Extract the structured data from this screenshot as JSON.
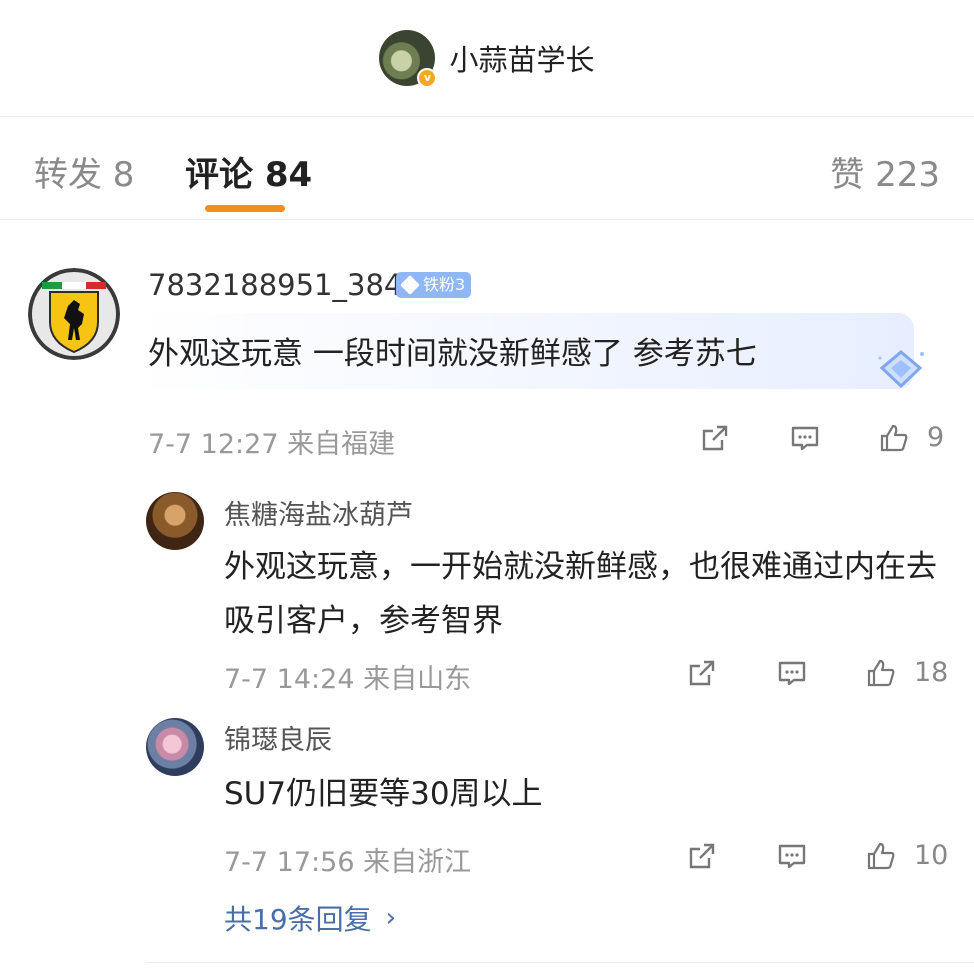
{
  "header": {
    "username": "小蒜苗学长"
  },
  "tabs": {
    "repost": "转发 8",
    "comment": "评论 84",
    "like": "赞 223"
  },
  "accent_color": "#f08f1d",
  "comments": [
    {
      "username": "7832188951_384",
      "badge": "铁粉3",
      "text": "外观这玩意 一段时间就没新鲜感了  参考苏七",
      "meta": "7-7 12:27  来自福建",
      "likes": "9"
    }
  ],
  "replies": [
    {
      "username": "焦糖海盐冰葫芦",
      "text": "外观这玩意，一开始就没新鲜感，也很难通过内在去吸引客户，参考智界",
      "meta": "7-7 14:24  来自山东",
      "likes": "18"
    },
    {
      "username": "锦璱良辰",
      "text": "SU7仍旧要等30周以上",
      "meta": "7-7 17:56  来自浙江",
      "likes": "10"
    }
  ],
  "more_replies": "共19条回复",
  "icons": {
    "share": "share-icon",
    "reply": "comment-icon",
    "like": "thumbs-up-icon",
    "more": "chevron-right-icon"
  }
}
